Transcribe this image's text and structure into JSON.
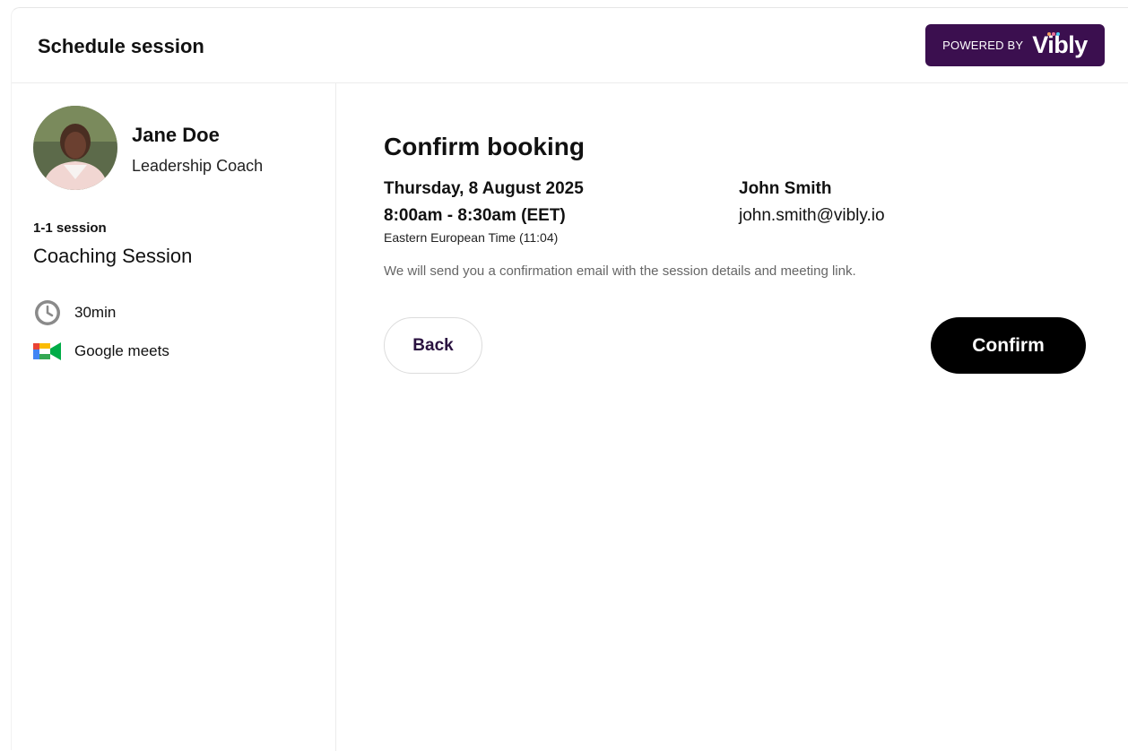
{
  "header": {
    "title": "Schedule session",
    "powered_by": "POWERED BY",
    "brand": "Vibly"
  },
  "coach": {
    "name": "Jane Doe",
    "title": "Leadership Coach"
  },
  "session": {
    "type": "1-1 session",
    "name": "Coaching Session",
    "duration": "30min",
    "location": "Google meets"
  },
  "booking": {
    "heading": "Confirm booking",
    "date": "Thursday, 8 August 2025",
    "time": "8:00am - 8:30am (EET)",
    "timezone": "Eastern European Time (11:04)",
    "client_name": "John Smith",
    "client_email": "john.smith@vibly.io",
    "notice": "We will send you a confirmation email with the session details and meeting link.",
    "back_label": "Back",
    "confirm_label": "Confirm"
  },
  "colors": {
    "brand_purple": "#3b0f4f",
    "confirm_bg": "#000000",
    "back_text": "#2a1240"
  }
}
